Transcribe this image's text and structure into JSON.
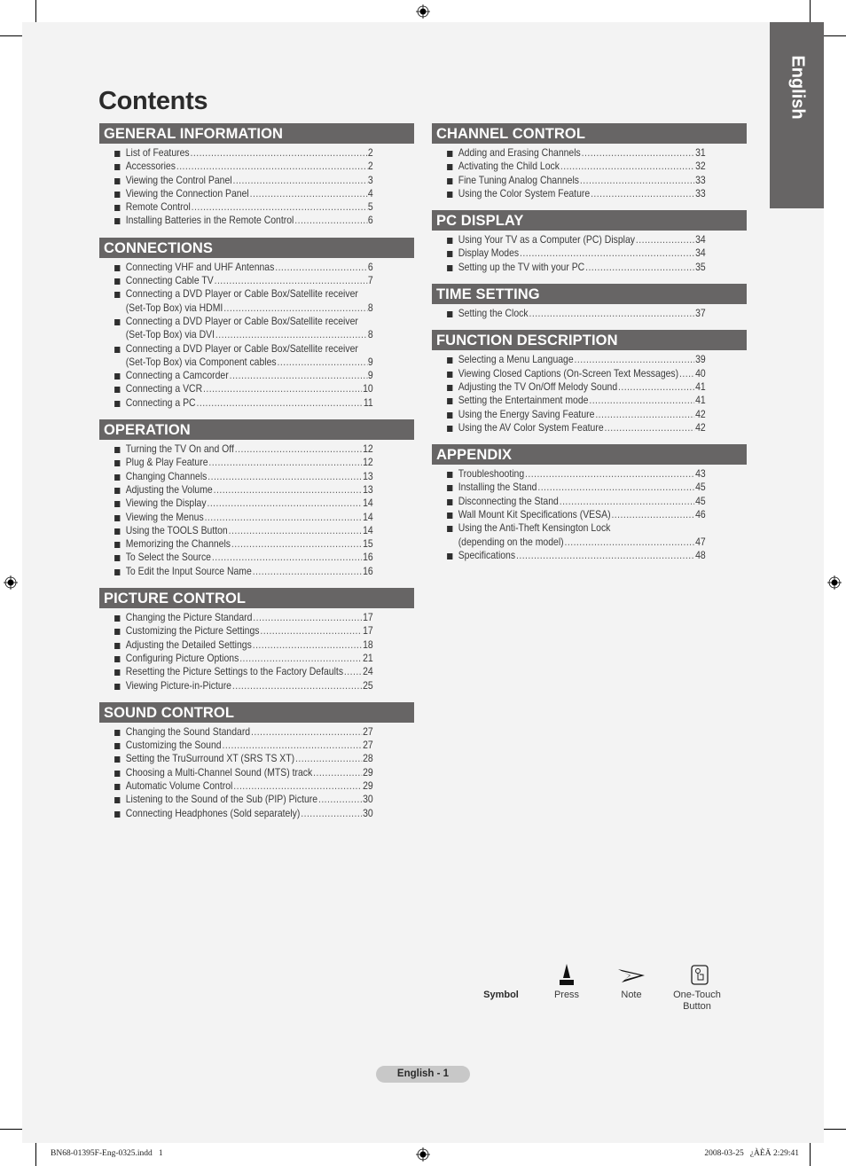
{
  "title": "Contents",
  "language_tab": "English",
  "left_column": [
    {
      "heading": "GENERAL INFORMATION",
      "items": [
        {
          "text": "List of Features",
          "page": "2"
        },
        {
          "text": "Accessories",
          "page": "2"
        },
        {
          "text": "Viewing the Control Panel",
          "page": "3"
        },
        {
          "text": "Viewing the Connection Panel",
          "page": "4"
        },
        {
          "text": "Remote Control",
          "page": "5"
        },
        {
          "text": "Installing Batteries in the Remote Control",
          "page": "6"
        }
      ]
    },
    {
      "heading": "CONNECTIONS",
      "items": [
        {
          "text": "Connecting VHF and UHF Antennas",
          "page": "6"
        },
        {
          "text": "Connecting Cable TV",
          "page": "7"
        },
        {
          "line1": "Connecting a DVD Player or Cable Box/Satellite receiver",
          "text": "(Set-Top Box) via HDMI",
          "page": "8"
        },
        {
          "line1": "Connecting a DVD Player or Cable Box/Satellite receiver",
          "text": "(Set-Top Box) via DVI",
          "page": "8"
        },
        {
          "line1": "Connecting a DVD Player or Cable Box/Satellite receiver",
          "text": "(Set-Top Box) via Component cables",
          "page": "9"
        },
        {
          "text": "Connecting a Camcorder",
          "page": "9"
        },
        {
          "text": "Connecting a VCR",
          "page": "10"
        },
        {
          "text": "Connecting a PC",
          "page": "11"
        }
      ]
    },
    {
      "heading": "OPERATION",
      "items": [
        {
          "text": "Turning the TV On and Off",
          "page": "12"
        },
        {
          "text": "Plug & Play Feature",
          "page": "12"
        },
        {
          "text": "Changing Channels",
          "page": "13"
        },
        {
          "text": "Adjusting the Volume",
          "page": "13"
        },
        {
          "text": "Viewing the Display",
          "page": "14"
        },
        {
          "text": "Viewing the Menus",
          "page": "14"
        },
        {
          "text": "Using the TOOLS Button",
          "page": "14"
        },
        {
          "text": "Memorizing the Channels",
          "page": "15"
        },
        {
          "text": "To Select the Source",
          "page": "16"
        },
        {
          "text": "To Edit the Input Source Name",
          "page": "16"
        }
      ]
    },
    {
      "heading": "PICTURE CONTROL",
      "items": [
        {
          "text": "Changing the Picture Standard",
          "page": "17"
        },
        {
          "text": "Customizing the Picture Settings",
          "page": "17"
        },
        {
          "text": "Adjusting the Detailed Settings",
          "page": "18"
        },
        {
          "text": "Configuring Picture Options",
          "page": "21"
        },
        {
          "text": "Resetting the Picture Settings to the Factory Defaults",
          "page": "24"
        },
        {
          "text": "Viewing Picture-in-Picture",
          "page": "25"
        }
      ]
    },
    {
      "heading": "SOUND CONTROL",
      "items": [
        {
          "text": "Changing the Sound Standard",
          "page": "27"
        },
        {
          "text": "Customizing the Sound",
          "page": "27"
        },
        {
          "text": "Setting the TruSurround XT (SRS TS XT)",
          "page": "28"
        },
        {
          "text": "Choosing a Multi-Channel Sound (MTS) track",
          "page": "29"
        },
        {
          "text": "Automatic Volume Control",
          "page": "29"
        },
        {
          "text": "Listening to the Sound of the Sub (PIP) Picture",
          "page": "30"
        },
        {
          "text": "Connecting Headphones (Sold separately)",
          "page": "30"
        }
      ]
    }
  ],
  "right_column": [
    {
      "heading": "CHANNEL CONTROL",
      "items": [
        {
          "text": "Adding and Erasing Channels",
          "page": "31"
        },
        {
          "text": "Activating the Child Lock",
          "page": "32"
        },
        {
          "text": "Fine Tuning Analog Channels",
          "page": "33"
        },
        {
          "text": "Using the Color System Feature",
          "page": "33"
        }
      ]
    },
    {
      "heading": "PC DISPLAY",
      "items": [
        {
          "text": "Using Your TV as a Computer (PC) Display",
          "page": "34"
        },
        {
          "text": "Display Modes",
          "page": "34"
        },
        {
          "text": "Setting up the TV with your PC",
          "page": "35"
        }
      ]
    },
    {
      "heading": "TIME SETTING",
      "items": [
        {
          "text": "Setting the Clock",
          "page": "37"
        }
      ]
    },
    {
      "heading": "FUNCTION DESCRIPTION",
      "items": [
        {
          "text": "Selecting a Menu Language",
          "page": "39"
        },
        {
          "text": "Viewing Closed Captions (On-Screen Text Messages)",
          "page": "40"
        },
        {
          "text": "Adjusting the TV On/Off Melody Sound",
          "page": "41"
        },
        {
          "text": "Setting the Entertainment mode",
          "page": "41"
        },
        {
          "text": "Using the Energy Saving Feature",
          "page": "42"
        },
        {
          "text": "Using the AV Color System Feature",
          "page": "42"
        }
      ]
    },
    {
      "heading": "APPENDIX",
      "items": [
        {
          "text": "Troubleshooting",
          "page": "43"
        },
        {
          "text": "Installing the Stand",
          "page": "45"
        },
        {
          "text": "Disconnecting the Stand",
          "page": "45"
        },
        {
          "text": "Wall Mount Kit Specifications (VESA)",
          "page": "46"
        },
        {
          "line1": "Using the Anti-Theft Kensington Lock",
          "text": "(depending on the model)",
          "page": "47"
        },
        {
          "text": "Specifications",
          "page": "48"
        }
      ]
    }
  ],
  "symbols": {
    "label": "Symbol",
    "press": "Press",
    "note": "Note",
    "one_touch_line1": "One-Touch",
    "one_touch_line2": "Button"
  },
  "footer": {
    "page_label": "English - 1",
    "slug_left": "BN68-01395F-Eng-0325.indd   1",
    "slug_right": "2008-03-25   ¿ÀÈÄ 2:29:41"
  },
  "colors": {
    "header_bg": "#676565",
    "page_bg": "#f3f3f3"
  }
}
